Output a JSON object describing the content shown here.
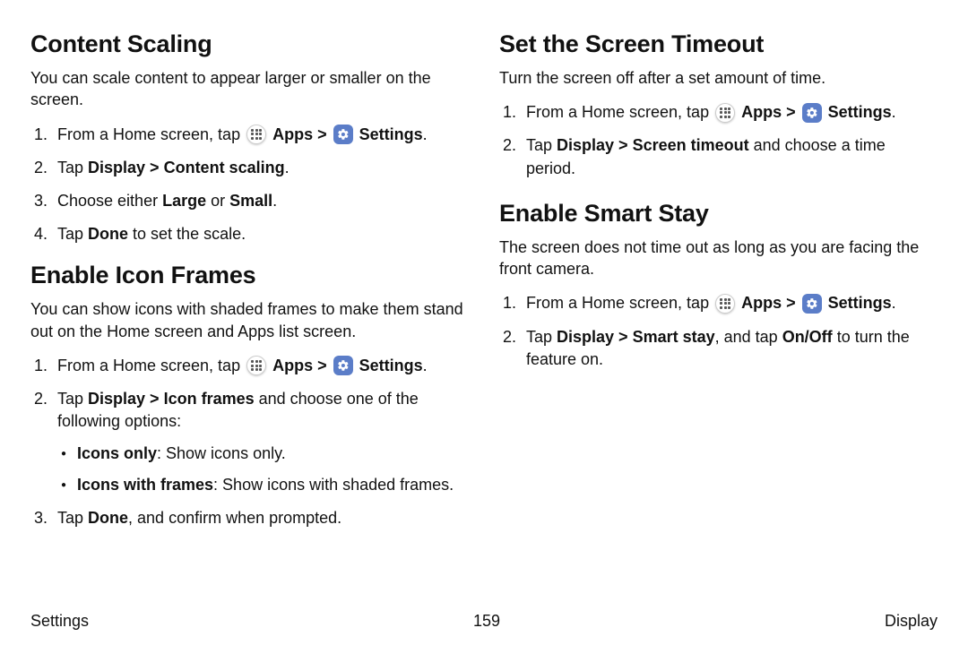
{
  "left": {
    "section1": {
      "title": "Content Scaling",
      "intro": "You can scale content to appear larger or smaller on the screen.",
      "s1a": "From a Home screen, tap ",
      "apps": "Apps",
      "gt": " > ",
      "settings": "Settings",
      "dot": ".",
      "s2a": "Tap ",
      "s2b": "Display > Content scaling",
      "s3a": "Choose either ",
      "s3b": "Large",
      "s3c": " or ",
      "s3d": "Small",
      "s4a": "Tap ",
      "s4b": "Done",
      "s4c": " to set the scale."
    },
    "section2": {
      "title": "Enable Icon Frames",
      "intro": "You can show icons with shaded frames to make them stand out on the Home screen and Apps list screen.",
      "s1a": "From a Home screen, tap ",
      "apps": "Apps",
      "gt": " > ",
      "settings": "Settings",
      "dot": ".",
      "s2a": "Tap ",
      "s2b": "Display > Icon frames",
      "s2c": " and choose one of the following options:",
      "b1a": "Icons only",
      "b1b": ": Show icons only.",
      "b2a": "Icons with frames",
      "b2b": ": Show icons with shaded frames.",
      "s3a": "Tap ",
      "s3b": "Done",
      "s3c": ", and confirm when prompted."
    }
  },
  "right": {
    "section1": {
      "title": "Set the Screen Timeout",
      "intro": "Turn the screen off after a set amount of time.",
      "s1a": "From a Home screen, tap ",
      "apps": "Apps",
      "gt": " > ",
      "settings": "Settings",
      "dot": ".",
      "s2a": "Tap ",
      "s2b": "Display > Screen timeout",
      "s2c": " and choose a time period."
    },
    "section2": {
      "title": "Enable Smart Stay",
      "intro": "The screen does not time out as long as you are facing the front camera.",
      "s1a": "From a Home screen, tap ",
      "apps": "Apps",
      "gt": " > ",
      "settings": "Settings",
      "dot": ".",
      "s2a": "Tap ",
      "s2b": "Display > Smart stay",
      "s2c": ", and tap ",
      "s2d": "On/Off",
      "s2e": " to turn the feature on."
    }
  },
  "footer": {
    "left": "Settings",
    "center": "159",
    "right": "Display"
  }
}
